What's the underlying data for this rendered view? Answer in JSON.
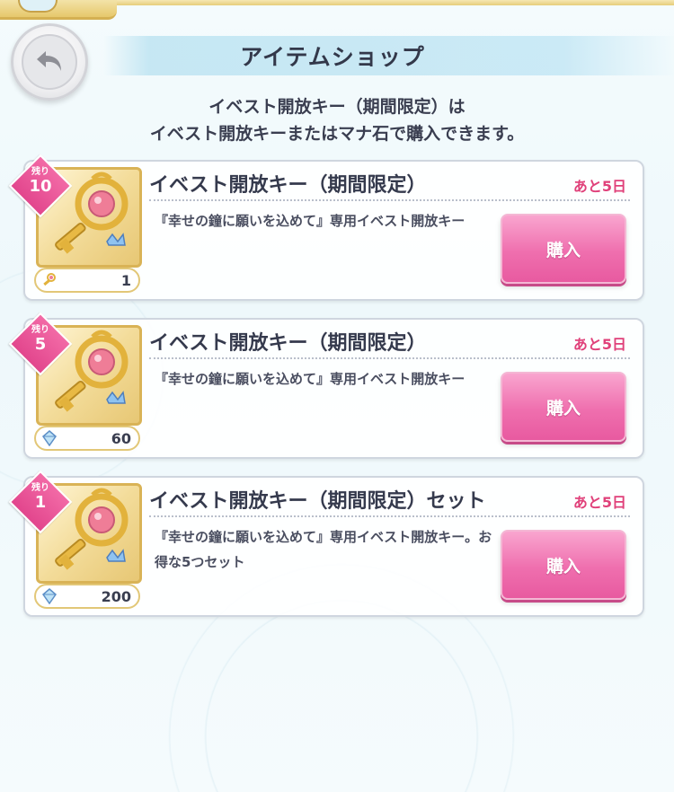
{
  "header": {
    "title": "アイテムショップ"
  },
  "notice": {
    "line1": "イベスト開放キー（期間限定）は",
    "line2": "イベスト開放キーまたはマナ石で購入できます。"
  },
  "items": [
    {
      "remaining_label": "残り",
      "remaining_count": "10",
      "title": "イベスト開放キー（期間限定）",
      "days_left": "あと5日",
      "description": "『幸せの鐘に願いを込めて』専用イベスト開放キー",
      "cost": "1",
      "cost_icon": "event-key-icon",
      "buy_label": "購入"
    },
    {
      "remaining_label": "残り",
      "remaining_count": "5",
      "title": "イベスト開放キー（期間限定）",
      "days_left": "あと5日",
      "description": "『幸せの鐘に願いを込めて』専用イベスト開放キー",
      "cost": "60",
      "cost_icon": "mana-stone-icon",
      "buy_label": "購入"
    },
    {
      "remaining_label": "残り",
      "remaining_count": "1",
      "title": "イベスト開放キー（期間限定）セット",
      "days_left": "あと5日",
      "description": "『幸せの鐘に願いを込めて』専用イベスト開放キー。お得な5つセット",
      "cost": "200",
      "cost_icon": "mana-stone-icon",
      "buy_label": "購入"
    }
  ],
  "colors": {
    "accent_pink": "#ef6fae",
    "days_left_text": "#e0417a",
    "remain_badge": "#e2468d",
    "thumb_border": "#d9b356"
  }
}
